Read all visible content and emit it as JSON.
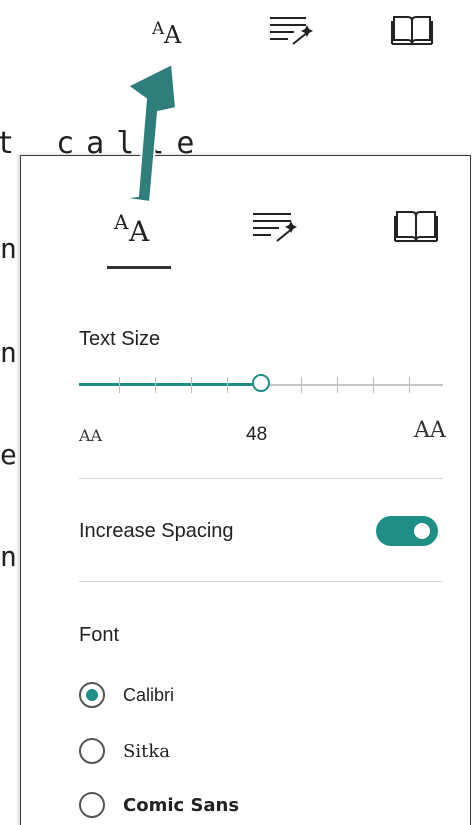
{
  "toolbar": {
    "icons": [
      "text-preferences-icon",
      "grammar-options-icon",
      "reading-preferences-icon"
    ],
    "text_pref_glyph": "AA"
  },
  "background_text": {
    "line1": "t calle",
    "fragments": [
      "n",
      "n",
      "e",
      "n"
    ]
  },
  "panel": {
    "tab_glyph": "AA",
    "text_size_label": "Text Size",
    "text_size_value": "48",
    "slider_fraction": 0.5,
    "slider_small_label": "AA",
    "slider_large_label": "AA",
    "increase_spacing_label": "Increase Spacing",
    "increase_spacing_on": true,
    "font_label": "Font",
    "font_options": [
      "Calibri",
      "Sitka",
      "Comic Sans"
    ],
    "selected_font": "Calibri"
  },
  "colors": {
    "accent": "#1f8f86",
    "arrow": "#2e7f7b"
  }
}
